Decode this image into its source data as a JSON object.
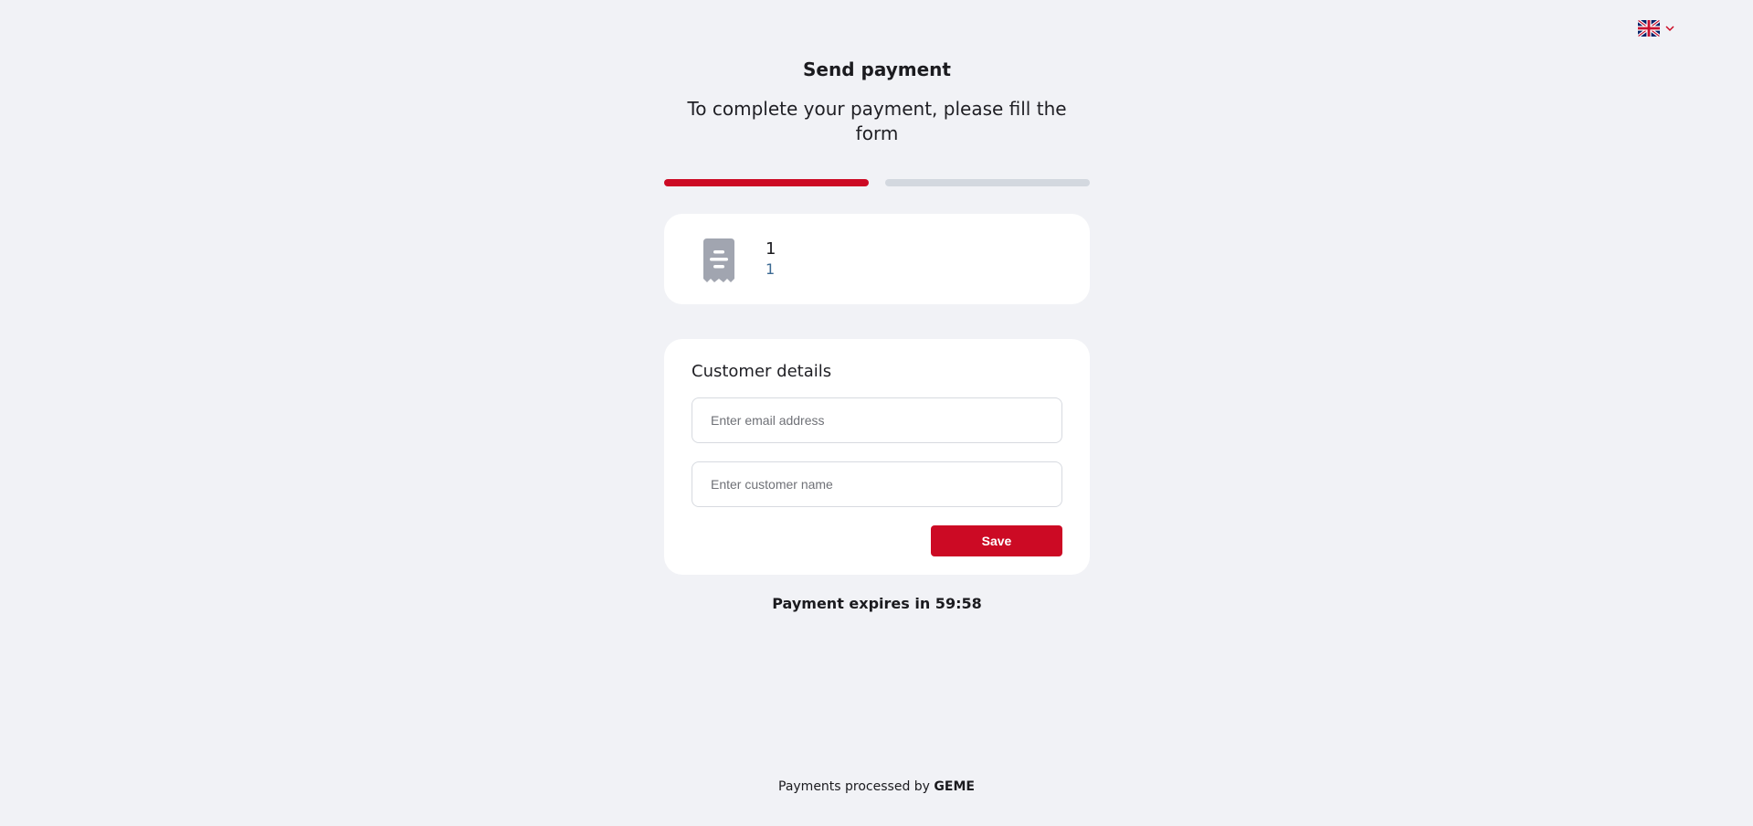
{
  "language": {
    "flag_icon": "uk-flag-icon",
    "chevron_icon": "chevron-down-icon",
    "accent_color": "#cc0a24"
  },
  "header": {
    "title": "Send payment",
    "subtitle": "To complete your payment, please fill the form"
  },
  "progress": {
    "current_step": 1,
    "total_steps": 2,
    "active_color": "#cc0a24",
    "inactive_color": "#d3d8df"
  },
  "order": {
    "icon": "receipt-icon",
    "primary": "1",
    "secondary": "1"
  },
  "customer": {
    "heading": "Customer details",
    "email_placeholder": "Enter email address",
    "email_value": "",
    "name_placeholder": "Enter customer name",
    "name_value": "",
    "save_label": "Save",
    "save_color": "#cc0a24"
  },
  "expiry": {
    "label": "Payment expires in 59:58"
  },
  "footer": {
    "prefix": "Payments processed by",
    "brand": "GEME"
  }
}
